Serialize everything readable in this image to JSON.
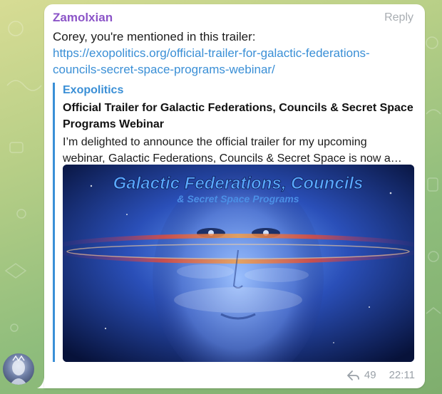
{
  "message": {
    "sender": "Zamolxian",
    "reply_label": "Reply",
    "text": "Corey, you're mentioned in this trailer:",
    "link": "https://exopolitics.org/official-trailer-for-galactic-federations-councils-secret-space-programs-webinar/",
    "forwards": "49",
    "time": "22:11"
  },
  "link_preview": {
    "site_name": "Exopolitics",
    "title": "Official Trailer for Galactic Federations, Councils & Secret Space Programs Webinar",
    "description_line1": "I’m delighted to announce the official trailer for my upcoming",
    "description_line2": "webinar, Galactic Federations, Councils & Secret Space is now a…",
    "image_title": "Galactic Federations, Councils",
    "image_subtitle": "& Secret Space Programs"
  },
  "icons": {
    "forward": "forward-arrow-icon",
    "avatar": "avatar"
  },
  "colors": {
    "sender": "#8c55c8",
    "link": "#3a8fd6",
    "meta": "#9aa1a8",
    "background": "#b8cf87"
  }
}
